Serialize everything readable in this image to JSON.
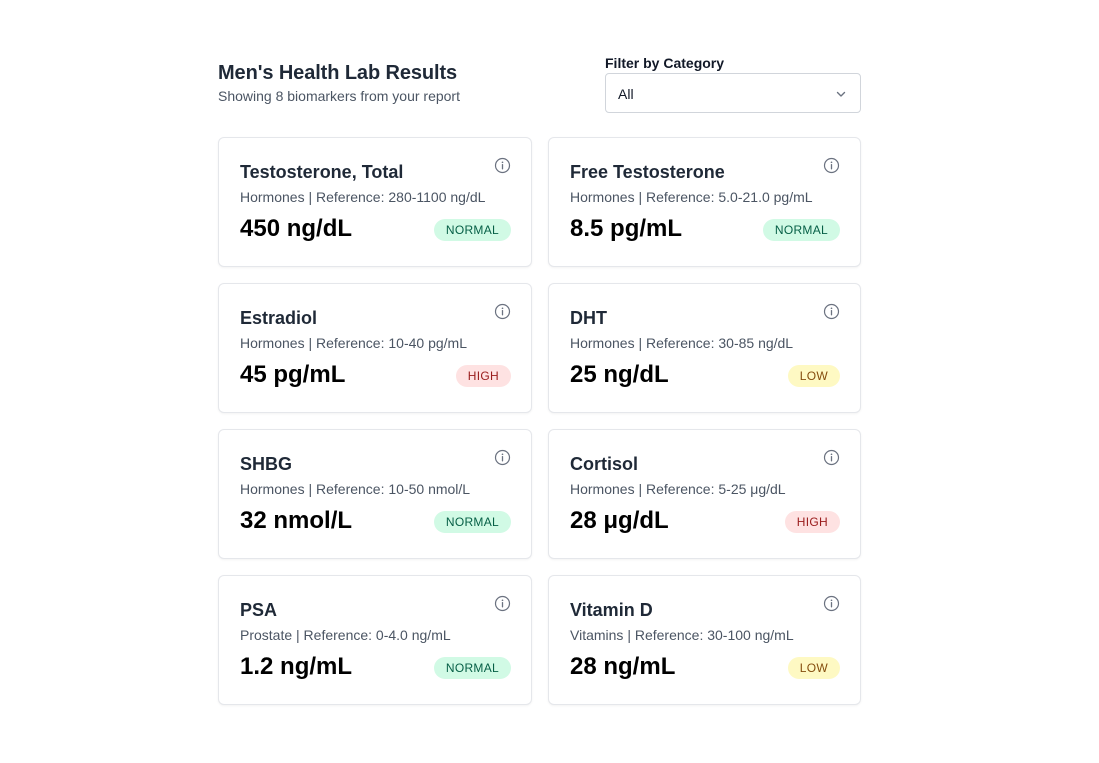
{
  "header": {
    "title": "Men's Health Lab Results",
    "subtitle": "Showing 8 biomarkers from your report"
  },
  "filter": {
    "label": "Filter by Category",
    "selected": "All",
    "icon": "chevron-down-icon"
  },
  "colors": {
    "normal_bg": "#d1fae5",
    "normal_text": "#065f46",
    "high_bg": "#fee2e2",
    "high_text": "#991b1b",
    "low_bg": "#fef9c3",
    "low_text": "#854d0e"
  },
  "biomarkers": [
    {
      "name": "Testosterone, Total",
      "meta": "Hormones | Reference: 280-1100 ng/dL",
      "value": "450 ng/dL",
      "status": "NORMAL"
    },
    {
      "name": "Free Testosterone",
      "meta": "Hormones | Reference: 5.0-21.0 pg/mL",
      "value": "8.5 pg/mL",
      "status": "NORMAL"
    },
    {
      "name": "Estradiol",
      "meta": "Hormones | Reference: 10-40 pg/mL",
      "value": "45 pg/mL",
      "status": "HIGH"
    },
    {
      "name": "DHT",
      "meta": "Hormones | Reference: 30-85 ng/dL",
      "value": "25 ng/dL",
      "status": "LOW"
    },
    {
      "name": "SHBG",
      "meta": "Hormones | Reference: 10-50 nmol/L",
      "value": "32 nmol/L",
      "status": "NORMAL"
    },
    {
      "name": "Cortisol",
      "meta": "Hormones | Reference: 5-25 μg/dL",
      "value": "28 μg/dL",
      "status": "HIGH"
    },
    {
      "name": "PSA",
      "meta": "Prostate | Reference: 0-4.0 ng/mL",
      "value": "1.2 ng/mL",
      "status": "NORMAL"
    },
    {
      "name": "Vitamin D",
      "meta": "Vitamins | Reference: 30-100 ng/mL",
      "value": "28 ng/mL",
      "status": "LOW"
    }
  ]
}
